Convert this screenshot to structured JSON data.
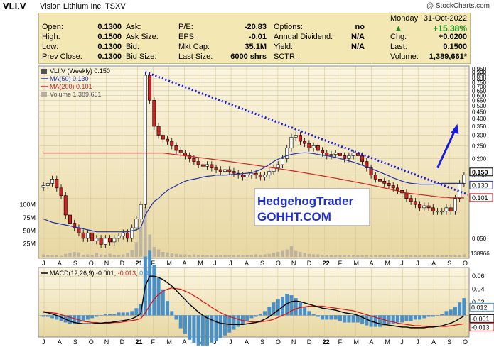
{
  "header": {
    "symbol": "VLI.V",
    "company": "Vision Lithium Inc.",
    "exchange": "TSXV",
    "credit": "@ StockCharts.com"
  },
  "quote": {
    "date_label": "Monday",
    "date": "31-Oct-2022",
    "change_pct": "+15.38%",
    "change_arrow": "▲",
    "rows": [
      {
        "l1": "Open:",
        "v1": "0.1300",
        "l2": "Ask:",
        "v2": "",
        "l3": "P/E:",
        "v3": "-20.83",
        "l4": "Options:",
        "v4": "no",
        "l5": "",
        "v5": ""
      },
      {
        "l1": "High:",
        "v1": "0.1500",
        "l2": "Ask Size:",
        "v2": "",
        "l3": "EPS:",
        "v3": "-0.01",
        "l4": "Annual Dividend:",
        "v4": "N/A",
        "l5": "Chg:",
        "v5": "+0.0200"
      },
      {
        "l1": "Low:",
        "v1": "0.1300",
        "l2": "Bid:",
        "v2": "",
        "l3": "Mkt Cap:",
        "v3": "35.1M",
        "l4": "Yield:",
        "v4": "N/A",
        "l5": "Last:",
        "v5": "0.1500"
      },
      {
        "l1": "Prev Close:",
        "v1": "0.1300",
        "l2": "Bid Size:",
        "v2": "",
        "l3": "Last Size:",
        "v3": "6000 shrs",
        "l4": "SCTR:",
        "v4": "",
        "l5": "Volume:",
        "v5": "1,389,661*"
      }
    ]
  },
  "legend": {
    "price": "VLI.V (Weekly) 0.150",
    "ma50": "MA(50) 0.130",
    "ma200": "MA(200) 0.101",
    "volume": "Volume 1,389,661",
    "macd_label": "MACD(12,26,9)",
    "macd_v1": "-0.001",
    "macd_v2": "-0.013",
    "macd_v3": "0.012"
  },
  "annotation": {
    "line1": "HedgehogTrader",
    "line2": "GOHHT.COM"
  },
  "price_labels": {
    "last": "0.150",
    "ma50": "0.130",
    "ma200": "0.101",
    "vol_last": "138966"
  },
  "macd_labels": {
    "hist": "0.012",
    "macd": "-0.001",
    "signal": "-0.013"
  },
  "colors": {
    "panel_bg_top": "#fbf6e2",
    "panel_bg_bottom": "#e8d7a2",
    "up_candle": "#ffffff",
    "down_candle": "#cc2222",
    "ma50": "#2233aa",
    "ma200": "#cc2222",
    "trendline": "#1a1adf",
    "macd": "#000000",
    "signal": "#dd1111",
    "histogram": "#4a90c8",
    "volume": "#b5ada0"
  },
  "chart_data": [
    {
      "type": "candlestick",
      "title": "VLI.V (Weekly) 0.150",
      "y_scale": "log",
      "ylim": [
        0.04,
        0.95
      ],
      "y_ticks": [
        0.95,
        0.9,
        0.85,
        0.8,
        0.75,
        0.7,
        0.65,
        0.6,
        0.55,
        0.5,
        0.45,
        0.4,
        0.35,
        0.3,
        0.25,
        0.2,
        0.15,
        0.1,
        0.05
      ],
      "volume_ticks": [
        "100M",
        "75M",
        "50M",
        "25M"
      ],
      "volume_tick_values": [
        100,
        75,
        50,
        25
      ],
      "x_labels": [
        "J",
        "A",
        "S",
        "O",
        "N",
        "D",
        "21",
        "F",
        "M",
        "A",
        "M",
        "J",
        "J",
        "A",
        "S",
        "O",
        "N",
        "D",
        "22",
        "F",
        "M",
        "A",
        "M",
        "J",
        "J",
        "A",
        "S",
        "O"
      ],
      "close": [
        0.125,
        0.13,
        0.14,
        0.12,
        0.105,
        0.075,
        0.065,
        0.06,
        0.055,
        0.05,
        0.055,
        0.048,
        0.05,
        0.045,
        0.05,
        0.047,
        0.05,
        0.052,
        0.055,
        0.05,
        0.06,
        0.07,
        0.09,
        0.85,
        0.55,
        0.35,
        0.3,
        0.28,
        0.27,
        0.25,
        0.23,
        0.22,
        0.21,
        0.2,
        0.19,
        0.18,
        0.175,
        0.18,
        0.17,
        0.165,
        0.16,
        0.165,
        0.16,
        0.155,
        0.15,
        0.145,
        0.15,
        0.155,
        0.15,
        0.145,
        0.15,
        0.16,
        0.17,
        0.18,
        0.2,
        0.24,
        0.29,
        0.3,
        0.27,
        0.26,
        0.24,
        0.25,
        0.23,
        0.22,
        0.21,
        0.215,
        0.22,
        0.21,
        0.2,
        0.21,
        0.22,
        0.21,
        0.19,
        0.17,
        0.15,
        0.14,
        0.135,
        0.13,
        0.125,
        0.12,
        0.115,
        0.11,
        0.1,
        0.095,
        0.09,
        0.085,
        0.088,
        0.085,
        0.08,
        0.08,
        0.08,
        0.085,
        0.08,
        0.1,
        0.13,
        0.15
      ],
      "ma50": [
        0.07,
        0.068,
        0.066,
        0.065,
        0.064,
        0.063,
        0.062,
        0.061,
        0.06,
        0.059,
        0.058,
        0.057,
        0.056,
        0.056,
        0.056,
        0.056,
        0.056,
        0.056,
        0.056,
        0.056,
        0.057,
        0.058,
        0.06,
        0.075,
        0.085,
        0.095,
        0.1,
        0.108,
        0.115,
        0.12,
        0.125,
        0.13,
        0.135,
        0.138,
        0.14,
        0.142,
        0.145,
        0.147,
        0.148,
        0.15,
        0.15,
        0.15,
        0.151,
        0.152,
        0.153,
        0.154,
        0.155,
        0.157,
        0.16,
        0.165,
        0.172,
        0.18,
        0.19,
        0.198,
        0.205,
        0.21,
        0.215,
        0.218,
        0.22,
        0.221,
        0.22,
        0.218,
        0.215,
        0.212,
        0.21,
        0.207,
        0.204,
        0.2,
        0.196,
        0.192,
        0.188,
        0.183,
        0.178,
        0.173,
        0.168,
        0.163,
        0.158,
        0.153,
        0.148,
        0.143,
        0.139,
        0.135,
        0.132,
        0.13,
        0.129,
        0.128,
        0.128,
        0.128,
        0.128,
        0.129,
        0.13,
        0.13,
        0.13,
        0.13,
        0.13,
        0.13
      ],
      "ma200": [
        0.22,
        0.22,
        0.22,
        0.22,
        0.22,
        0.22,
        0.22,
        0.22,
        0.22,
        0.22,
        0.22,
        0.22,
        0.22,
        0.22,
        0.22,
        0.22,
        0.22,
        0.22,
        0.22,
        0.22,
        0.22,
        0.22,
        0.22,
        0.22,
        0.22,
        0.22,
        0.22,
        0.22,
        0.218,
        0.216,
        0.214,
        0.212,
        0.21,
        0.208,
        0.206,
        0.204,
        0.202,
        0.2,
        0.198,
        0.196,
        0.194,
        0.192,
        0.19,
        0.188,
        0.186,
        0.184,
        0.182,
        0.18,
        0.178,
        0.176,
        0.174,
        0.172,
        0.17,
        0.168,
        0.166,
        0.164,
        0.162,
        0.16,
        0.158,
        0.156,
        0.154,
        0.152,
        0.15,
        0.148,
        0.146,
        0.144,
        0.142,
        0.14,
        0.138,
        0.136,
        0.134,
        0.132,
        0.13,
        0.128,
        0.126,
        0.124,
        0.122,
        0.12,
        0.118,
        0.116,
        0.114,
        0.112,
        0.11,
        0.109,
        0.108,
        0.107,
        0.106,
        0.105,
        0.104,
        0.103,
        0.102,
        0.102,
        0.101,
        0.101,
        0.101,
        0.101
      ],
      "volume_relative": [
        5,
        4,
        3,
        3,
        2,
        6,
        8,
        10,
        9,
        4,
        5,
        3,
        8,
        5,
        4,
        6,
        4,
        3,
        5,
        8,
        14,
        30,
        60,
        100,
        45,
        20,
        15,
        10,
        9,
        7,
        6,
        5,
        5,
        4,
        5,
        4,
        3,
        4,
        3,
        3,
        4,
        3,
        3,
        3,
        4,
        3,
        3,
        4,
        5,
        4,
        5,
        6,
        8,
        10,
        12,
        15,
        22,
        12,
        10,
        8,
        6,
        5,
        5,
        4,
        4,
        4,
        3,
        3,
        3,
        4,
        3,
        3,
        4,
        3,
        3,
        3,
        3,
        3,
        3,
        3,
        4,
        3,
        3,
        3,
        3,
        3,
        3,
        3,
        3,
        3,
        3,
        3,
        3,
        4,
        4,
        5
      ]
    },
    {
      "type": "line",
      "title": "MACD(12,26,9) -0.001, -0.013, 0.012",
      "ylim": [
        -0.03,
        0.07
      ],
      "y_ticks": [
        0.06,
        0.04,
        0.02
      ],
      "macd": [
        0.005,
        0.004,
        0.002,
        0.0,
        -0.003,
        -0.006,
        -0.009,
        -0.011,
        -0.012,
        -0.013,
        -0.013,
        -0.013,
        -0.012,
        -0.012,
        -0.011,
        -0.011,
        -0.01,
        -0.009,
        -0.008,
        -0.007,
        -0.005,
        -0.002,
        0.003,
        0.045,
        0.06,
        0.06,
        0.058,
        0.055,
        0.05,
        0.045,
        0.038,
        0.031,
        0.024,
        0.017,
        0.011,
        0.005,
        0.0,
        -0.004,
        -0.007,
        -0.01,
        -0.012,
        -0.013,
        -0.014,
        -0.014,
        -0.014,
        -0.014,
        -0.013,
        -0.012,
        -0.011,
        -0.009,
        -0.006,
        -0.002,
        0.003,
        0.008,
        0.013,
        0.018,
        0.021,
        0.022,
        0.021,
        0.019,
        0.017,
        0.015,
        0.013,
        0.011,
        0.01,
        0.009,
        0.008,
        0.006,
        0.004,
        0.003,
        0.002,
        0.0,
        -0.003,
        -0.006,
        -0.009,
        -0.011,
        -0.013,
        -0.014,
        -0.015,
        -0.016,
        -0.017,
        -0.018,
        -0.018,
        -0.019,
        -0.019,
        -0.019,
        -0.019,
        -0.018,
        -0.018,
        -0.017,
        -0.016,
        -0.014,
        -0.012,
        -0.009,
        -0.005,
        -0.001
      ],
      "signal": [
        0.006,
        0.005,
        0.004,
        0.003,
        0.001,
        -0.001,
        -0.003,
        -0.005,
        -0.007,
        -0.009,
        -0.01,
        -0.011,
        -0.011,
        -0.012,
        -0.012,
        -0.012,
        -0.011,
        -0.011,
        -0.01,
        -0.009,
        -0.008,
        -0.007,
        -0.005,
        0.004,
        0.015,
        0.025,
        0.032,
        0.037,
        0.04,
        0.042,
        0.041,
        0.04,
        0.037,
        0.034,
        0.03,
        0.026,
        0.021,
        0.017,
        0.012,
        0.008,
        0.004,
        0.001,
        -0.002,
        -0.004,
        -0.006,
        -0.008,
        -0.009,
        -0.01,
        -0.01,
        -0.01,
        -0.009,
        -0.008,
        -0.006,
        -0.003,
        0.0,
        0.003,
        0.007,
        0.01,
        0.012,
        0.013,
        0.014,
        0.014,
        0.014,
        0.014,
        0.013,
        0.012,
        0.011,
        0.01,
        0.009,
        0.008,
        0.007,
        0.005,
        0.003,
        0.001,
        -0.001,
        -0.003,
        -0.005,
        -0.007,
        -0.009,
        -0.01,
        -0.012,
        -0.013,
        -0.014,
        -0.015,
        -0.016,
        -0.016,
        -0.017,
        -0.017,
        -0.017,
        -0.017,
        -0.017,
        -0.017,
        -0.016,
        -0.015,
        -0.014,
        -0.013
      ]
    }
  ]
}
